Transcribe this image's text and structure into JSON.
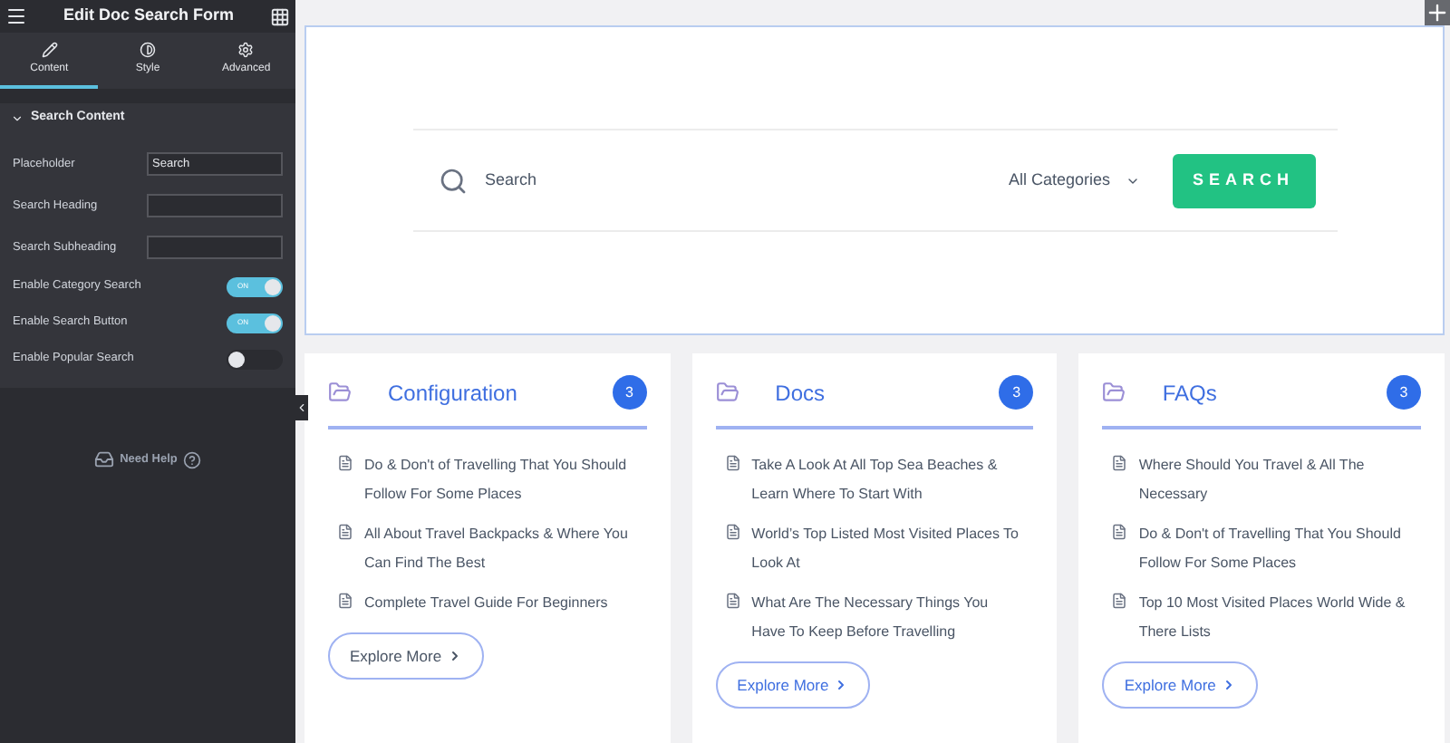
{
  "panel": {
    "title": "Edit Doc Search Form",
    "tabs": [
      {
        "label": "Content",
        "selected": true
      },
      {
        "label": "Style",
        "selected": false
      },
      {
        "label": "Advanced",
        "selected": false
      }
    ],
    "section": {
      "title": "Search Content",
      "expanded": true
    },
    "fields": [
      {
        "label": "Placeholder",
        "value": "Search"
      },
      {
        "label": "Search Heading"
      },
      {
        "label": "Search Subheading"
      }
    ],
    "toggles": [
      {
        "label": "Enable Category Search",
        "on": true,
        "text": "ON"
      },
      {
        "label": "Enable Search Button",
        "on": true,
        "text": "ON"
      },
      {
        "label": "Enable Popular Search",
        "on": false
      }
    ],
    "help": "Need Help"
  },
  "search_form": {
    "placeholder": "Search",
    "category": "All Categories",
    "button": "SEARCH"
  },
  "cards": [
    {
      "title": "Configuration",
      "count": "3",
      "items": [
        "Do & Don't of Travelling That You Should Follow For Some Places",
        "All About Travel Backpacks & Where You Can Find The Best",
        "Complete Travel Guide For Beginners"
      ],
      "button": "Explore More",
      "hovered": true
    },
    {
      "title": "Docs",
      "count": "3",
      "items": [
        "Take A Look At All Top Sea Beaches & Learn Where To Start With",
        "World’s Top Listed Most Visited Places To Look At",
        "What Are The Necessary Things You Have To Keep Before Travelling"
      ],
      "button": "Explore More",
      "hovered": false
    },
    {
      "title": "FAQs",
      "count": "3",
      "items": [
        "Where Should You Travel & All The Necessary",
        "Do & Don't of Travelling That You Should Follow For Some Places",
        "Top 10 Most Visited Places World Wide & There Lists"
      ],
      "button": "Explore More",
      "hovered": false
    }
  ]
}
